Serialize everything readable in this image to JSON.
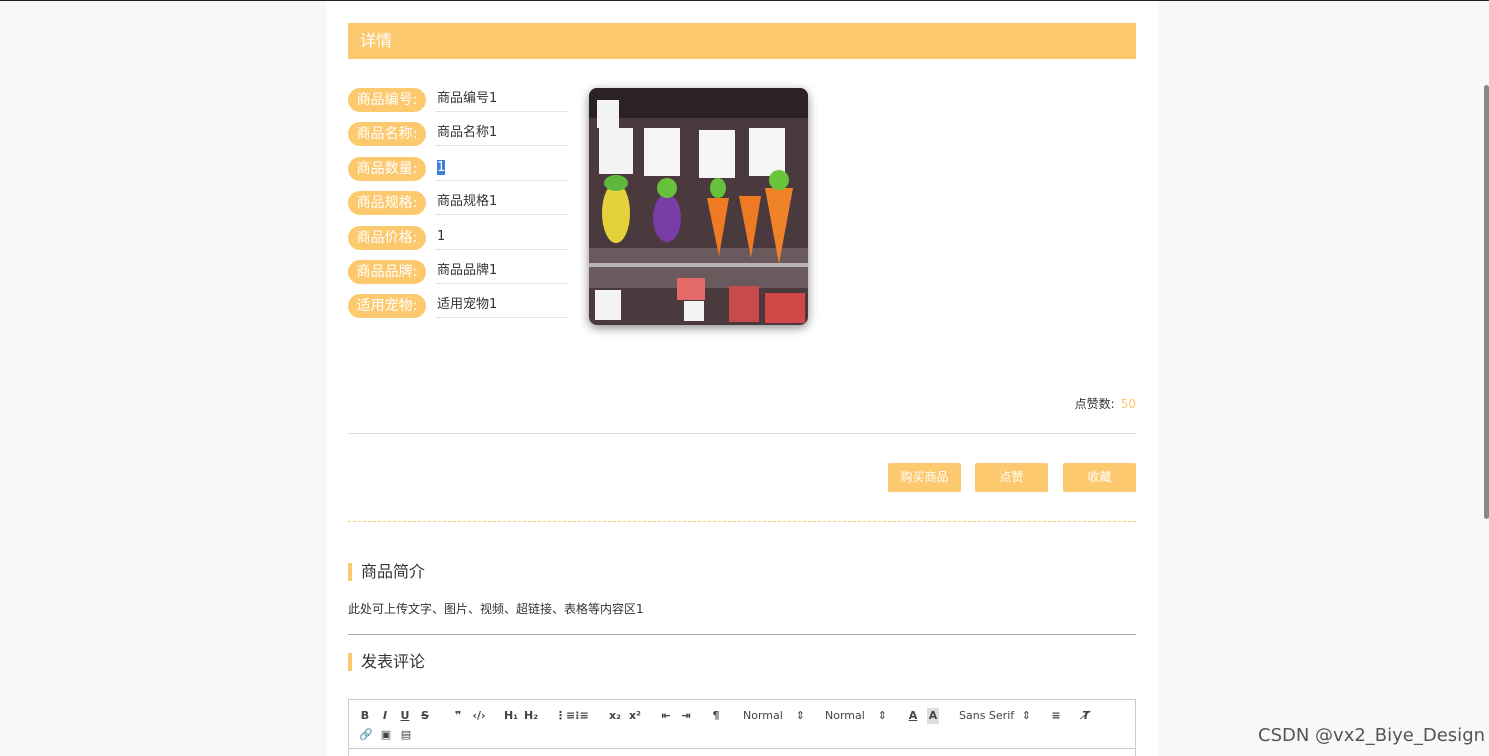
{
  "header": {
    "title": "详情"
  },
  "fields": [
    {
      "label": "商品编号:",
      "value": "商品编号1"
    },
    {
      "label": "商品名称:",
      "value": "商品名称1"
    },
    {
      "label": "商品数量:",
      "value": "1"
    },
    {
      "label": "商品规格:",
      "value": "商品规格1"
    },
    {
      "label": "商品价格:",
      "value": "1"
    },
    {
      "label": "商品品牌:",
      "value": "商品品牌1"
    },
    {
      "label": "适用宠物:",
      "value": "适用宠物1"
    }
  ],
  "likes": {
    "label": "点赞数:",
    "value": "50"
  },
  "actions": {
    "buy": "购买商品",
    "like": "点赞",
    "favorite": "收藏"
  },
  "intro": {
    "title": "商品简介",
    "text": "此处可上传文字、图片、视频、超链接、表格等内容区1"
  },
  "comment": {
    "title": "发表评论",
    "toolbar": {
      "size_select": "Normal",
      "header_select": "Normal",
      "font_select": "Sans Serif"
    }
  },
  "watermark": "CSDN @vx2_Biye_Design",
  "colors": {
    "accent": "#fdc96f",
    "selection": "#3d7fdc"
  }
}
